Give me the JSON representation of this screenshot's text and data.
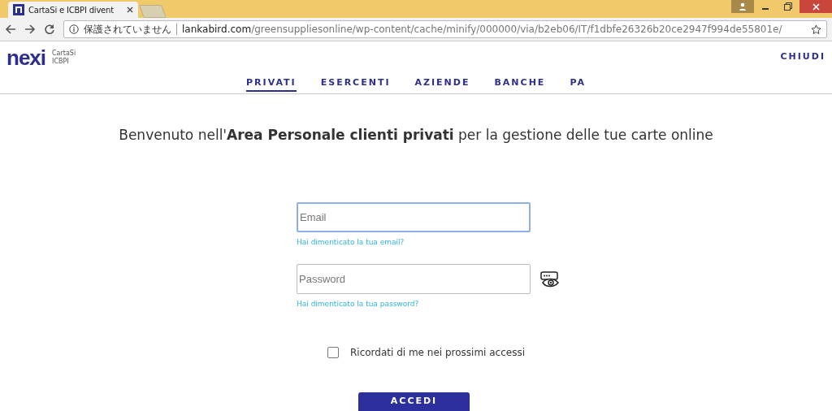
{
  "browser": {
    "tab_title": "CartaSi e ICBPI divent",
    "security_label": "保護されていません",
    "url_host": "lankabird.com",
    "url_path": "/greensuppliesonline/wp-content/cache/minify/000000/via/b2eb06/IT/f1dbfe26326b20ce2947f994de55801e/"
  },
  "header": {
    "logo": "nexi",
    "sub_logo_1": "CartaSi",
    "sub_logo_2": "ICBPI",
    "close": "CHIUDI"
  },
  "nav": [
    {
      "label": "PRIVATI",
      "selected": true
    },
    {
      "label": "ESERCENTI",
      "selected": false
    },
    {
      "label": "AZIENDE",
      "selected": false
    },
    {
      "label": "BANCHE",
      "selected": false
    },
    {
      "label": "PA",
      "selected": false
    }
  ],
  "heading": "Benvenuto nell'**Area Personale clienti privati** per la gestione delle tue carte online",
  "email": {
    "placeholder": "Email",
    "focused": true,
    "link": "Hai dimenticato la tua email?"
  },
  "password": {
    "placeholder": "Password",
    "link": "Hai dimenticato la tua password?"
  },
  "remember": {
    "label": "Ricordati di me nei prossimi accessi",
    "checked": false
  },
  "submit": "ACCEDI"
}
